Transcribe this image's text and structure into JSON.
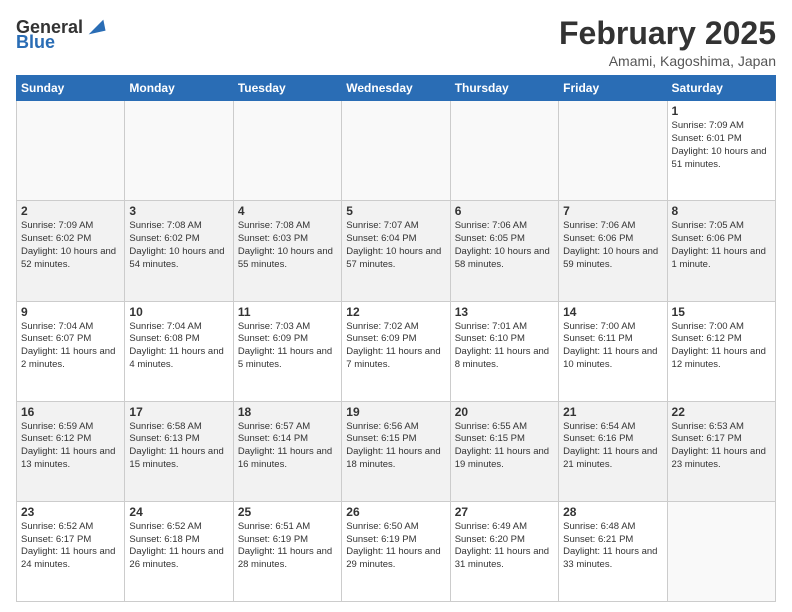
{
  "header": {
    "logo_general": "General",
    "logo_blue": "Blue",
    "month": "February 2025",
    "location": "Amami, Kagoshima, Japan"
  },
  "days_of_week": [
    "Sunday",
    "Monday",
    "Tuesday",
    "Wednesday",
    "Thursday",
    "Friday",
    "Saturday"
  ],
  "weeks": [
    [
      {
        "day": null
      },
      {
        "day": null
      },
      {
        "day": null
      },
      {
        "day": null
      },
      {
        "day": null
      },
      {
        "day": null
      },
      {
        "day": 1,
        "sunrise": "7:09 AM",
        "sunset": "6:01 PM",
        "daylight": "10 hours and 51 minutes."
      }
    ],
    [
      {
        "day": 2,
        "sunrise": "7:09 AM",
        "sunset": "6:02 PM",
        "daylight": "10 hours and 52 minutes."
      },
      {
        "day": 3,
        "sunrise": "7:08 AM",
        "sunset": "6:02 PM",
        "daylight": "10 hours and 54 minutes."
      },
      {
        "day": 4,
        "sunrise": "7:08 AM",
        "sunset": "6:03 PM",
        "daylight": "10 hours and 55 minutes."
      },
      {
        "day": 5,
        "sunrise": "7:07 AM",
        "sunset": "6:04 PM",
        "daylight": "10 hours and 57 minutes."
      },
      {
        "day": 6,
        "sunrise": "7:06 AM",
        "sunset": "6:05 PM",
        "daylight": "10 hours and 58 minutes."
      },
      {
        "day": 7,
        "sunrise": "7:06 AM",
        "sunset": "6:06 PM",
        "daylight": "10 hours and 59 minutes."
      },
      {
        "day": 8,
        "sunrise": "7:05 AM",
        "sunset": "6:06 PM",
        "daylight": "11 hours and 1 minute."
      }
    ],
    [
      {
        "day": 9,
        "sunrise": "7:04 AM",
        "sunset": "6:07 PM",
        "daylight": "11 hours and 2 minutes."
      },
      {
        "day": 10,
        "sunrise": "7:04 AM",
        "sunset": "6:08 PM",
        "daylight": "11 hours and 4 minutes."
      },
      {
        "day": 11,
        "sunrise": "7:03 AM",
        "sunset": "6:09 PM",
        "daylight": "11 hours and 5 minutes."
      },
      {
        "day": 12,
        "sunrise": "7:02 AM",
        "sunset": "6:09 PM",
        "daylight": "11 hours and 7 minutes."
      },
      {
        "day": 13,
        "sunrise": "7:01 AM",
        "sunset": "6:10 PM",
        "daylight": "11 hours and 8 minutes."
      },
      {
        "day": 14,
        "sunrise": "7:00 AM",
        "sunset": "6:11 PM",
        "daylight": "11 hours and 10 minutes."
      },
      {
        "day": 15,
        "sunrise": "7:00 AM",
        "sunset": "6:12 PM",
        "daylight": "11 hours and 12 minutes."
      }
    ],
    [
      {
        "day": 16,
        "sunrise": "6:59 AM",
        "sunset": "6:12 PM",
        "daylight": "11 hours and 13 minutes."
      },
      {
        "day": 17,
        "sunrise": "6:58 AM",
        "sunset": "6:13 PM",
        "daylight": "11 hours and 15 minutes."
      },
      {
        "day": 18,
        "sunrise": "6:57 AM",
        "sunset": "6:14 PM",
        "daylight": "11 hours and 16 minutes."
      },
      {
        "day": 19,
        "sunrise": "6:56 AM",
        "sunset": "6:15 PM",
        "daylight": "11 hours and 18 minutes."
      },
      {
        "day": 20,
        "sunrise": "6:55 AM",
        "sunset": "6:15 PM",
        "daylight": "11 hours and 19 minutes."
      },
      {
        "day": 21,
        "sunrise": "6:54 AM",
        "sunset": "6:16 PM",
        "daylight": "11 hours and 21 minutes."
      },
      {
        "day": 22,
        "sunrise": "6:53 AM",
        "sunset": "6:17 PM",
        "daylight": "11 hours and 23 minutes."
      }
    ],
    [
      {
        "day": 23,
        "sunrise": "6:52 AM",
        "sunset": "6:17 PM",
        "daylight": "11 hours and 24 minutes."
      },
      {
        "day": 24,
        "sunrise": "6:52 AM",
        "sunset": "6:18 PM",
        "daylight": "11 hours and 26 minutes."
      },
      {
        "day": 25,
        "sunrise": "6:51 AM",
        "sunset": "6:19 PM",
        "daylight": "11 hours and 28 minutes."
      },
      {
        "day": 26,
        "sunrise": "6:50 AM",
        "sunset": "6:19 PM",
        "daylight": "11 hours and 29 minutes."
      },
      {
        "day": 27,
        "sunrise": "6:49 AM",
        "sunset": "6:20 PM",
        "daylight": "11 hours and 31 minutes."
      },
      {
        "day": 28,
        "sunrise": "6:48 AM",
        "sunset": "6:21 PM",
        "daylight": "11 hours and 33 minutes."
      },
      {
        "day": null
      }
    ]
  ]
}
